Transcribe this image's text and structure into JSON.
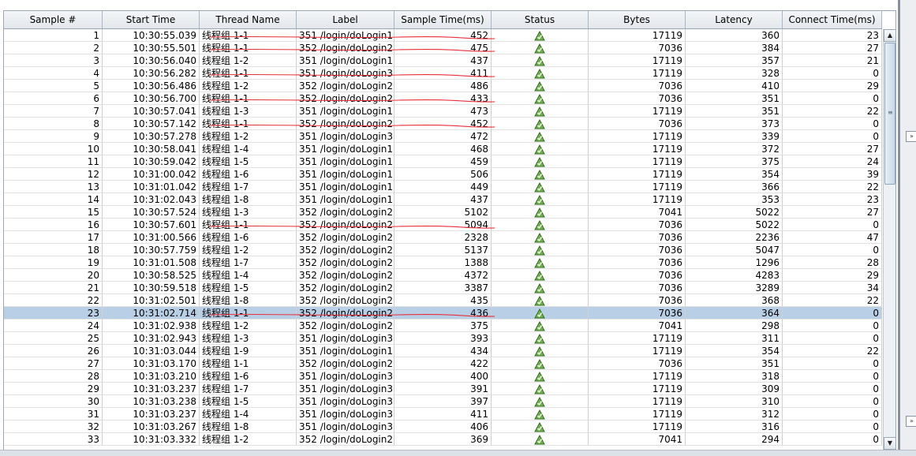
{
  "table": {
    "columns": [
      "Sample #",
      "Start Time",
      "Thread Name",
      "Label",
      "Sample Time(ms)",
      "Status",
      "Bytes",
      "Latency",
      "Connect Time(ms)"
    ],
    "status_icon": "success-shield-icon",
    "selected_row": 23,
    "annotation_color": "#e8303a",
    "rows": [
      [
        "1",
        "10:30:55.039",
        "线程组 1-1",
        "351 /login/doLogin1",
        "452",
        "17119",
        "360",
        "23"
      ],
      [
        "2",
        "10:30:55.501",
        "线程组 1-1",
        "352 /login/doLogin2",
        "475",
        "7036",
        "384",
        "27"
      ],
      [
        "3",
        "10:30:56.040",
        "线程组 1-2",
        "351 /login/doLogin1",
        "437",
        "17119",
        "357",
        "21"
      ],
      [
        "4",
        "10:30:56.282",
        "线程组 1-1",
        "351 /login/doLogin3",
        "411",
        "17119",
        "328",
        "0"
      ],
      [
        "5",
        "10:30:56.486",
        "线程组 1-2",
        "352 /login/doLogin2",
        "486",
        "7036",
        "410",
        "29"
      ],
      [
        "6",
        "10:30:56.700",
        "线程组 1-1",
        "352 /login/doLogin2",
        "433",
        "7036",
        "351",
        "0"
      ],
      [
        "7",
        "10:30:57.041",
        "线程组 1-3",
        "351 /login/doLogin1",
        "473",
        "17119",
        "351",
        "22"
      ],
      [
        "8",
        "10:30:57.142",
        "线程组 1-1",
        "352 /login/doLogin2",
        "452",
        "7036",
        "373",
        "0"
      ],
      [
        "9",
        "10:30:57.278",
        "线程组 1-2",
        "351 /login/doLogin3",
        "472",
        "17119",
        "339",
        "0"
      ],
      [
        "10",
        "10:30:58.041",
        "线程组 1-4",
        "351 /login/doLogin1",
        "468",
        "17119",
        "372",
        "27"
      ],
      [
        "11",
        "10:30:59.042",
        "线程组 1-5",
        "351 /login/doLogin1",
        "459",
        "17119",
        "375",
        "24"
      ],
      [
        "12",
        "10:31:00.042",
        "线程组 1-6",
        "351 /login/doLogin1",
        "506",
        "17119",
        "354",
        "39"
      ],
      [
        "13",
        "10:31:01.042",
        "线程组 1-7",
        "351 /login/doLogin1",
        "449",
        "17119",
        "366",
        "22"
      ],
      [
        "14",
        "10:31:02.043",
        "线程组 1-8",
        "351 /login/doLogin1",
        "437",
        "17119",
        "353",
        "23"
      ],
      [
        "15",
        "10:30:57.524",
        "线程组 1-3",
        "352 /login/doLogin2",
        "5102",
        "7041",
        "5022",
        "27"
      ],
      [
        "16",
        "10:30:57.601",
        "线程组 1-1",
        "352 /login/doLogin2",
        "5094",
        "7036",
        "5022",
        "0"
      ],
      [
        "17",
        "10:31:00.566",
        "线程组 1-6",
        "352 /login/doLogin2",
        "2328",
        "7036",
        "2236",
        "47"
      ],
      [
        "18",
        "10:30:57.759",
        "线程组 1-2",
        "352 /login/doLogin2",
        "5137",
        "7036",
        "5047",
        "0"
      ],
      [
        "19",
        "10:31:01.508",
        "线程组 1-7",
        "352 /login/doLogin2",
        "1388",
        "7036",
        "1296",
        "28"
      ],
      [
        "20",
        "10:30:58.525",
        "线程组 1-4",
        "352 /login/doLogin2",
        "4372",
        "7036",
        "4283",
        "29"
      ],
      [
        "21",
        "10:30:59.518",
        "线程组 1-5",
        "352 /login/doLogin2",
        "3387",
        "7036",
        "3289",
        "34"
      ],
      [
        "22",
        "10:31:02.501",
        "线程组 1-8",
        "352 /login/doLogin2",
        "435",
        "7036",
        "368",
        "22"
      ],
      [
        "23",
        "10:31:02.714",
        "线程组 1-1",
        "352 /login/doLogin2",
        "436",
        "7036",
        "364",
        "0"
      ],
      [
        "24",
        "10:31:02.938",
        "线程组 1-2",
        "352 /login/doLogin2",
        "375",
        "7041",
        "298",
        "0"
      ],
      [
        "25",
        "10:31:02.943",
        "线程组 1-3",
        "351 /login/doLogin3",
        "393",
        "17119",
        "311",
        "0"
      ],
      [
        "26",
        "10:31:03.044",
        "线程组 1-9",
        "351 /login/doLogin1",
        "434",
        "17119",
        "354",
        "22"
      ],
      [
        "27",
        "10:31:03.170",
        "线程组 1-1",
        "352 /login/doLogin2",
        "422",
        "7036",
        "351",
        "0"
      ],
      [
        "28",
        "10:31:03.210",
        "线程组 1-6",
        "351 /login/doLogin3",
        "400",
        "17119",
        "318",
        "0"
      ],
      [
        "29",
        "10:31:03.237",
        "线程组 1-7",
        "351 /login/doLogin3",
        "391",
        "17119",
        "309",
        "0"
      ],
      [
        "30",
        "10:31:03.238",
        "线程组 1-5",
        "351 /login/doLogin3",
        "397",
        "17119",
        "310",
        "0"
      ],
      [
        "31",
        "10:31:03.237",
        "线程组 1-4",
        "351 /login/doLogin3",
        "411",
        "17119",
        "312",
        "0"
      ],
      [
        "32",
        "10:31:03.267",
        "线程组 1-8",
        "351 /login/doLogin3",
        "406",
        "17119",
        "316",
        "0"
      ],
      [
        "33",
        "10:31:03.332",
        "线程组 1-2",
        "352 /login/doLogin2",
        "369",
        "7041",
        "294",
        "0"
      ]
    ]
  }
}
